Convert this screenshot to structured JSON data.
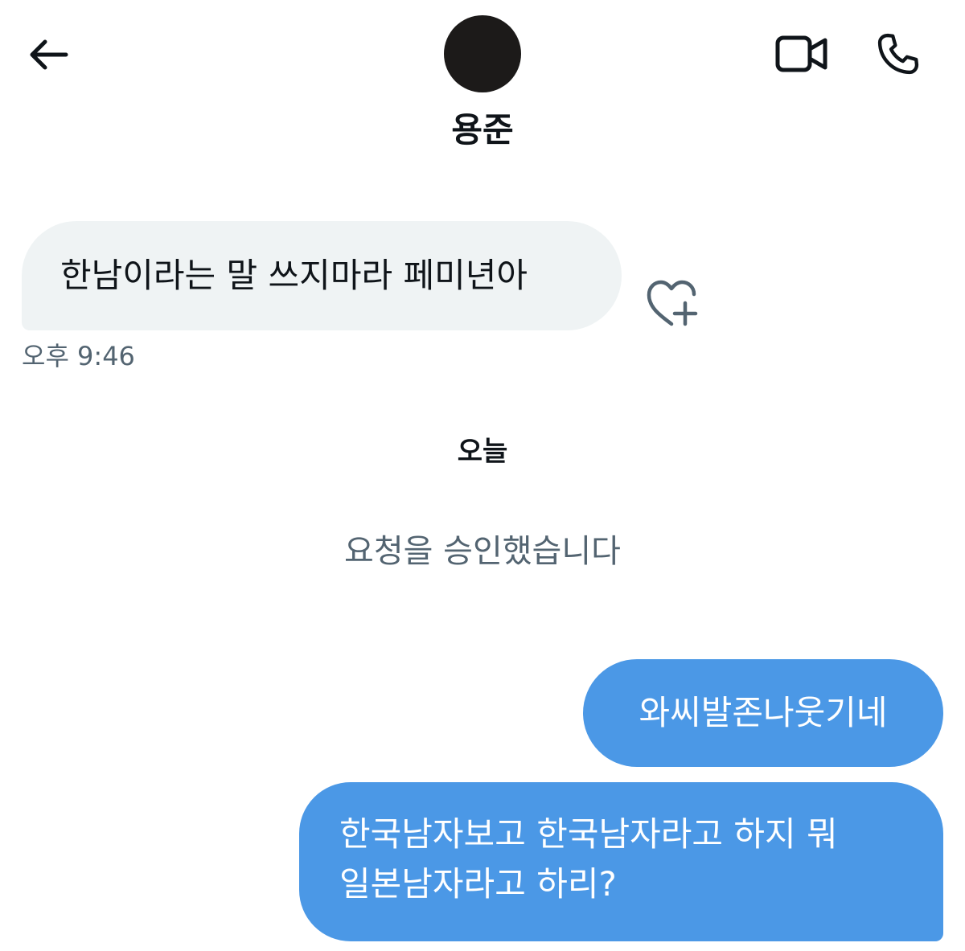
{
  "header": {
    "contact_name": "용준",
    "icons": {
      "back": "arrow-left-icon",
      "video": "video-camera-icon",
      "call": "phone-icon"
    }
  },
  "conversation": {
    "received": [
      {
        "text": "한남이라는 말 쓰지마라 페미년아",
        "time": "오후 9:46"
      }
    ],
    "reaction_icon": "heart-plus-icon",
    "date_divider": "오늘",
    "system_message": "요청을 승인했습니다",
    "sent": [
      {
        "lines": [
          "와씨발존나웃기네"
        ]
      },
      {
        "lines": [
          "한국남자보고 한국남자라고 하지 뭐",
          "일본남자라고 하리?"
        ]
      }
    ]
  },
  "colors": {
    "sent_bubble": "#4b98e6",
    "received_bubble": "#eff3f4",
    "secondary_text": "#536471",
    "primary_text": "#0f1419"
  }
}
